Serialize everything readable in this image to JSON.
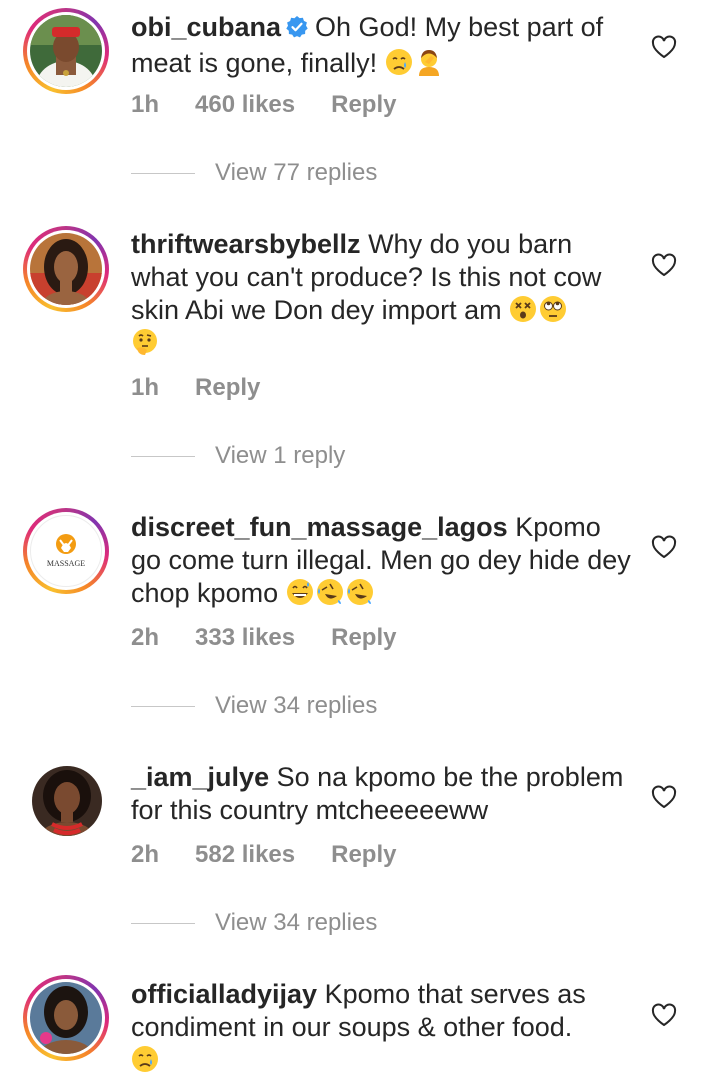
{
  "colors": {
    "text": "#262626",
    "secondary": "#8e8e8e",
    "verified_blue": "#3897f0",
    "story_ring": [
      "#f9c02e",
      "#f58529",
      "#dd2a7b",
      "#8134af"
    ]
  },
  "comments": [
    {
      "username": "obi_cubana",
      "verified": true,
      "text": "Oh God! My best part of meat is gone, finally!",
      "emojis": [
        "crying-face-emoji",
        "person-facepalming-emoji"
      ],
      "time": "1h",
      "likes": "460 likes",
      "reply_label": "Reply",
      "view_replies": "View 77 replies"
    },
    {
      "username": "thriftwearsbybellz",
      "verified": false,
      "text": "Why do you barn what you can't produce? Is this not cow skin Abi we Don dey import am",
      "emojis": [
        "dizzy-face-emoji",
        "eye-roll-emoji",
        "thinking-face-emoji"
      ],
      "time": "1h",
      "likes": "",
      "reply_label": "Reply",
      "view_replies": "View 1 reply"
    },
    {
      "username": "discreet_fun_massage_lagos",
      "verified": false,
      "avatar_text": "MASSAGE",
      "text": "Kpomo go come turn illegal. Men go dey hide dey chop kpomo",
      "emojis": [
        "grinning-sweat-emoji",
        "rofl-emoji",
        "rofl-emoji"
      ],
      "time": "2h",
      "likes": "333 likes",
      "reply_label": "Reply",
      "view_replies": "View 34 replies"
    },
    {
      "username": "_iam_julye",
      "verified": false,
      "text": "So na kpomo be the problem for this country mtcheeeeeww",
      "emojis": [],
      "time": "2h",
      "likes": "582 likes",
      "reply_label": "Reply",
      "view_replies": "View 34 replies"
    },
    {
      "username": "officialladyijay",
      "verified": false,
      "text": "Kpomo that serves as condiment in our soups & other food.",
      "emojis": [
        "crying-face-emoji"
      ],
      "time": "",
      "likes": "",
      "reply_label": "",
      "view_replies": ""
    }
  ]
}
